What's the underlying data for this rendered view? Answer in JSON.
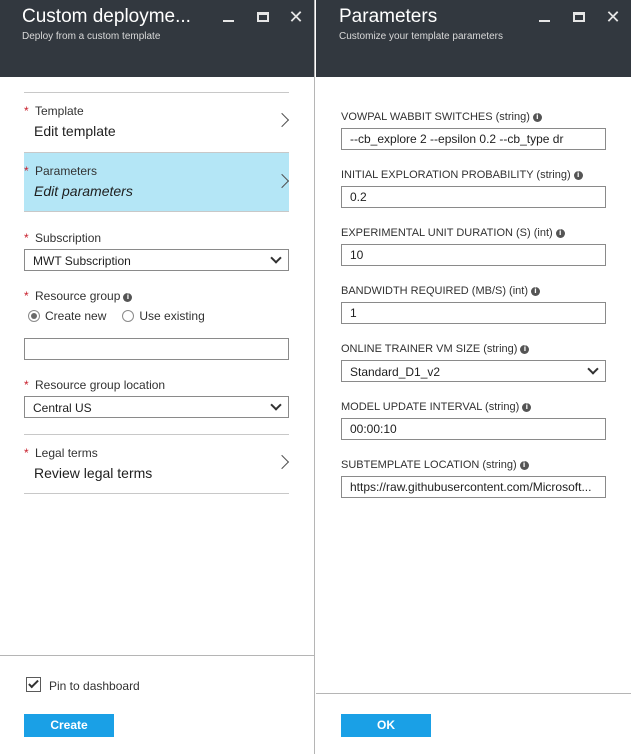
{
  "left_blade": {
    "title": "Custom deployme...",
    "subtitle": "Deploy from a custom template",
    "template": {
      "label": "Template",
      "value": "Edit template"
    },
    "parameters": {
      "label": "Parameters",
      "value": "Edit parameters"
    },
    "subscription": {
      "label": "Subscription",
      "selected": "MWT Subscription"
    },
    "resource_group": {
      "label": "Resource group",
      "option_create": "Create new",
      "option_existing": "Use existing",
      "name_value": ""
    },
    "location": {
      "label": "Resource group location",
      "selected": "Central US"
    },
    "legal": {
      "label": "Legal terms",
      "value": "Review legal terms"
    },
    "pin_label": "Pin to dashboard",
    "create_label": "Create"
  },
  "right_blade": {
    "title": "Parameters",
    "subtitle": "Customize your template parameters",
    "params": [
      {
        "label": "VOWPAL WABBIT SWITCHES (string)",
        "value": "--cb_explore 2 --epsilon 0.2 --cb_type dr"
      },
      {
        "label": "INITIAL EXPLORATION PROBABILITY (string)",
        "value": "0.2"
      },
      {
        "label": "EXPERIMENTAL UNIT DURATION (S) (int)",
        "value": "10"
      },
      {
        "label": "BANDWIDTH REQUIRED (MB/S) (int)",
        "value": "1"
      },
      {
        "label": "ONLINE TRAINER VM SIZE (string)",
        "value": "Standard_D1_v2"
      },
      {
        "label": "MODEL UPDATE INTERVAL (string)",
        "value": "00:00:10"
      },
      {
        "label": "SUBTEMPLATE LOCATION (string)",
        "value": "https://raw.githubusercontent.com/Microsoft..."
      }
    ],
    "ok_label": "OK"
  },
  "colors": {
    "header_bg": "#32383f",
    "selected_item_bg": "#b4e6f6",
    "primary_button": "#1aa0e6",
    "required_star": "#c8202d"
  },
  "icons": {
    "minimize": "minimize-icon",
    "maximize": "maximize-icon",
    "close": "close-icon",
    "chevron": "chevron-right-icon",
    "caret": "chevron-down-icon",
    "info": "info-icon",
    "check": "checkmark-icon"
  }
}
